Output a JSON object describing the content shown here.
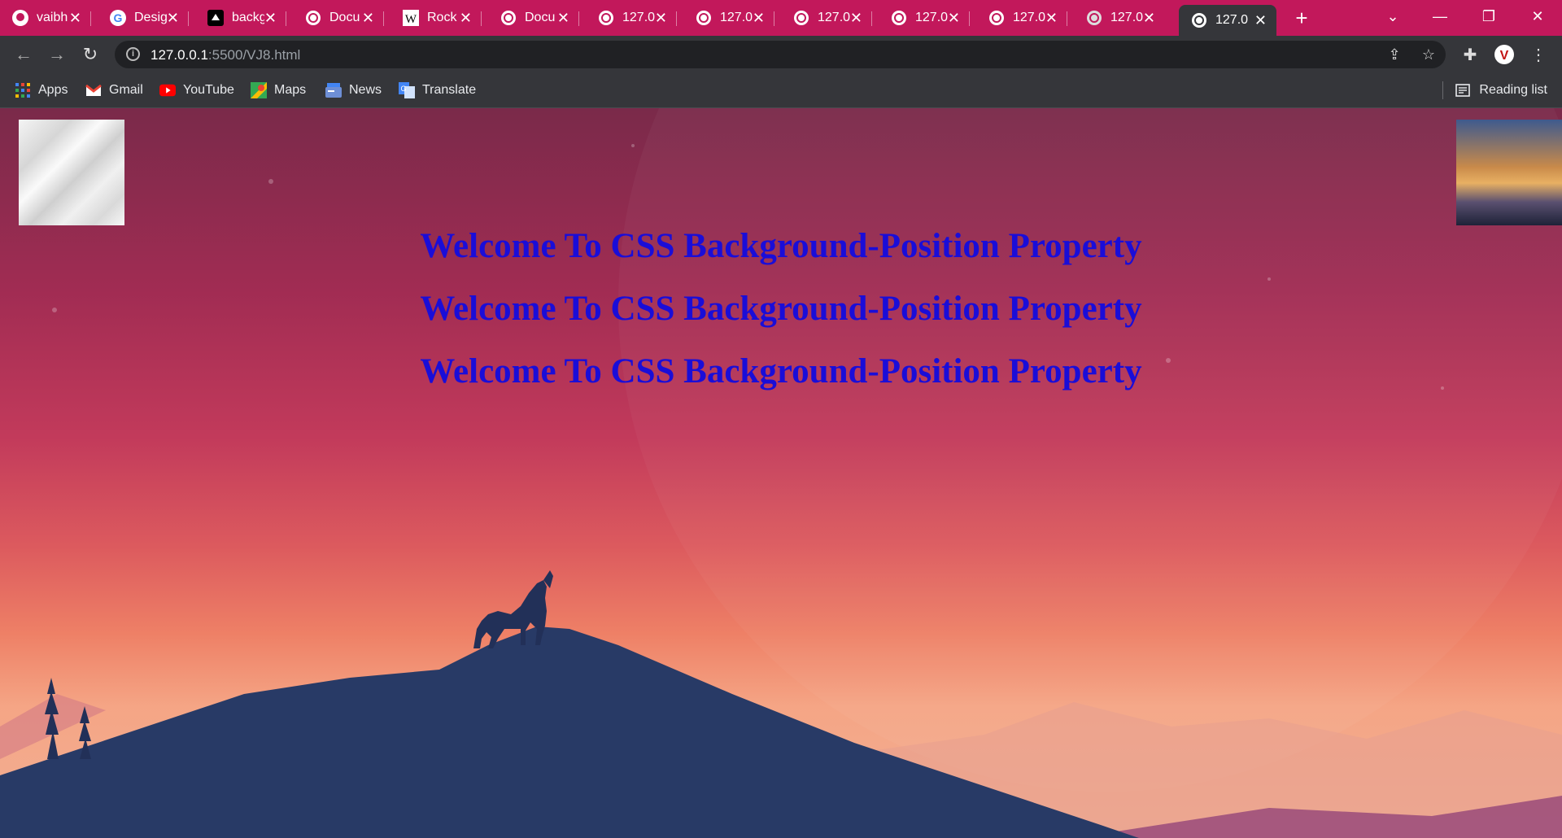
{
  "tabs": [
    {
      "title": "vaibh",
      "icon": "github-icon"
    },
    {
      "title": "Desig",
      "icon": "google-icon"
    },
    {
      "title": "backg",
      "icon": "site-icon"
    },
    {
      "title": "Docu",
      "icon": "globe-icon"
    },
    {
      "title": "Rock",
      "icon": "wikipedia-icon"
    },
    {
      "title": "Docu",
      "icon": "globe-icon"
    },
    {
      "title": "127.0",
      "icon": "globe-icon"
    },
    {
      "title": "127.0",
      "icon": "globe-icon"
    },
    {
      "title": "127.0",
      "icon": "globe-icon"
    },
    {
      "title": "127.0",
      "icon": "globe-icon"
    },
    {
      "title": "127.0",
      "icon": "globe-icon"
    },
    {
      "title": "127.0",
      "icon": "globe-icon"
    },
    {
      "title": "127.0",
      "icon": "globe-icon",
      "active": true
    }
  ],
  "address": {
    "host": "127.0.0.1",
    "path": ":5500/VJ8.html"
  },
  "bookmarks": [
    {
      "label": "Apps",
      "icon": "apps-grid-icon"
    },
    {
      "label": "Gmail",
      "icon": "gmail-icon"
    },
    {
      "label": "YouTube",
      "icon": "youtube-icon"
    },
    {
      "label": "Maps",
      "icon": "maps-icon"
    },
    {
      "label": "News",
      "icon": "news-icon"
    },
    {
      "label": "Translate",
      "icon": "translate-icon"
    }
  ],
  "reading_list": "Reading list",
  "page": {
    "headings": [
      "Welcome To CSS Background-Position Property",
      "Welcome To CSS Background-Position Property",
      "Welcome To CSS Background-Position Property"
    ]
  },
  "colors": {
    "tabbar": "#c2185b",
    "heading": "#1a0dd8"
  }
}
